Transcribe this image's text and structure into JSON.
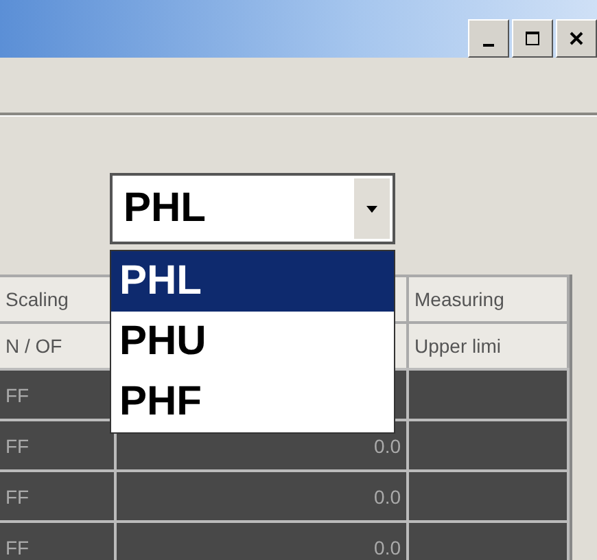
{
  "combo": {
    "value": "PHL"
  },
  "dropdown": {
    "options": [
      {
        "label": "PHL",
        "selected": true
      },
      {
        "label": "PHU",
        "selected": false
      },
      {
        "label": "PHF",
        "selected": false
      }
    ]
  },
  "table": {
    "header_rows": [
      [
        "Scaling",
        "",
        "Measuring"
      ],
      [
        "N / OF",
        "",
        "Upper limi"
      ]
    ],
    "rows": [
      [
        "FF",
        "",
        ""
      ],
      [
        "FF",
        "0.0",
        ""
      ],
      [
        "FF",
        "0.0",
        ""
      ],
      [
        "FF",
        "0.0",
        ""
      ]
    ]
  }
}
